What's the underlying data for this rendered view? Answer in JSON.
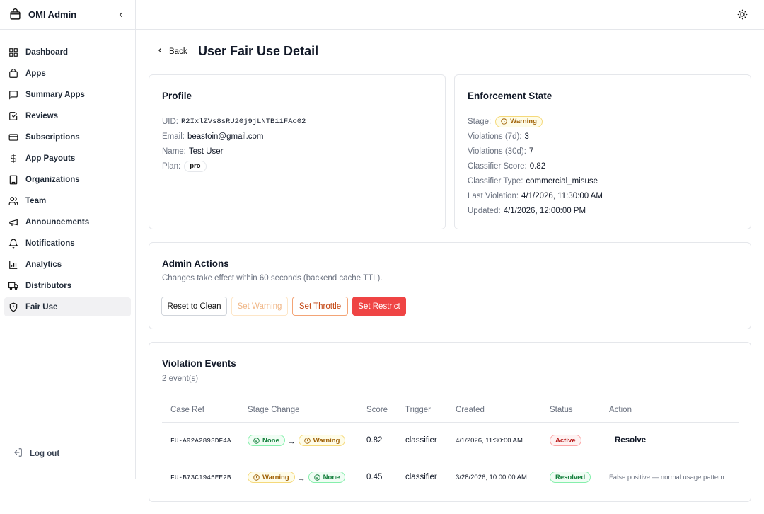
{
  "app": {
    "title": "OMI Admin"
  },
  "sidebar": {
    "items": [
      {
        "label": "Dashboard",
        "icon": "dashboard-icon"
      },
      {
        "label": "Apps",
        "icon": "apps-icon"
      },
      {
        "label": "Summary Apps",
        "icon": "summary-apps-icon"
      },
      {
        "label": "Reviews",
        "icon": "reviews-icon"
      },
      {
        "label": "Subscriptions",
        "icon": "subscriptions-icon"
      },
      {
        "label": "App Payouts",
        "icon": "dollar-icon"
      },
      {
        "label": "Organizations",
        "icon": "building-icon"
      },
      {
        "label": "Team",
        "icon": "team-icon"
      },
      {
        "label": "Announcements",
        "icon": "megaphone-icon"
      },
      {
        "label": "Notifications",
        "icon": "bell-icon"
      },
      {
        "label": "Analytics",
        "icon": "analytics-icon"
      },
      {
        "label": "Distributors",
        "icon": "truck-icon"
      },
      {
        "label": "Fair Use",
        "icon": "shield-icon",
        "active": true
      }
    ],
    "logout_label": "Log out"
  },
  "header": {
    "back_label": "Back",
    "page_title": "User Fair Use Detail"
  },
  "profile": {
    "title": "Profile",
    "uid_label": "UID:",
    "uid": "R2IxlZVs8sRU20j9jLNTBiiFAo02",
    "email_label": "Email:",
    "email": "beastoin@gmail.com",
    "name_label": "Name:",
    "name": "Test User",
    "plan_label": "Plan:",
    "plan": "pro"
  },
  "enforcement": {
    "title": "Enforcement State",
    "stage_label": "Stage:",
    "stage": "Warning",
    "v7_label": "Violations (7d):",
    "v7": "3",
    "v30_label": "Violations (30d):",
    "v30": "7",
    "score_label": "Classifier Score:",
    "score": "0.82",
    "type_label": "Classifier Type:",
    "type": "commercial_misuse",
    "last_label": "Last Violation:",
    "last": "4/1/2026, 11:30:00 AM",
    "updated_label": "Updated:",
    "updated": "4/1/2026, 12:00:00 PM"
  },
  "admin_actions": {
    "title": "Admin Actions",
    "subtitle": "Changes take effect within 60 seconds (backend cache TTL).",
    "buttons": {
      "clean": "Reset to Clean",
      "warning": "Set Warning",
      "throttle": "Set Throttle",
      "restrict": "Set Restrict"
    }
  },
  "violations": {
    "title": "Violation Events",
    "count_text": "2 event(s)",
    "columns": [
      "Case Ref",
      "Stage Change",
      "Score",
      "Trigger",
      "Created",
      "Status",
      "Action"
    ],
    "rows": [
      {
        "case_ref": "FU-A92A2893DF4A",
        "from": "None",
        "to": "Warning",
        "score": "0.82",
        "trigger": "classifier",
        "created": "4/1/2026, 11:30:00 AM",
        "status": "Active",
        "action": "Resolve"
      },
      {
        "case_ref": "FU-B73C1945EE2B",
        "from": "Warning",
        "to": "None",
        "score": "0.45",
        "trigger": "classifier",
        "created": "3/28/2026, 10:00:00 AM",
        "status": "Resolved",
        "action": "False positive — normal usage pattern"
      }
    ],
    "arrow": "→"
  },
  "colors": {
    "accent_red": "#ef4444",
    "warning_amber": "#a16207",
    "success_green": "#15803d"
  }
}
